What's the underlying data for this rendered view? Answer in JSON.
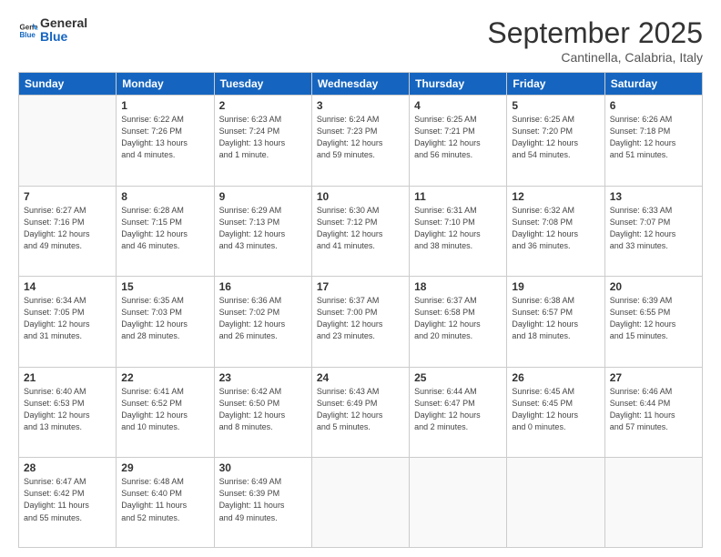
{
  "logo": {
    "line1": "General",
    "line2": "Blue"
  },
  "title": "September 2025",
  "subtitle": "Cantinella, Calabria, Italy",
  "days_header": [
    "Sunday",
    "Monday",
    "Tuesday",
    "Wednesday",
    "Thursday",
    "Friday",
    "Saturday"
  ],
  "weeks": [
    [
      {
        "day": "",
        "info": ""
      },
      {
        "day": "1",
        "info": "Sunrise: 6:22 AM\nSunset: 7:26 PM\nDaylight: 13 hours\nand 4 minutes."
      },
      {
        "day": "2",
        "info": "Sunrise: 6:23 AM\nSunset: 7:24 PM\nDaylight: 13 hours\nand 1 minute."
      },
      {
        "day": "3",
        "info": "Sunrise: 6:24 AM\nSunset: 7:23 PM\nDaylight: 12 hours\nand 59 minutes."
      },
      {
        "day": "4",
        "info": "Sunrise: 6:25 AM\nSunset: 7:21 PM\nDaylight: 12 hours\nand 56 minutes."
      },
      {
        "day": "5",
        "info": "Sunrise: 6:25 AM\nSunset: 7:20 PM\nDaylight: 12 hours\nand 54 minutes."
      },
      {
        "day": "6",
        "info": "Sunrise: 6:26 AM\nSunset: 7:18 PM\nDaylight: 12 hours\nand 51 minutes."
      }
    ],
    [
      {
        "day": "7",
        "info": "Sunrise: 6:27 AM\nSunset: 7:16 PM\nDaylight: 12 hours\nand 49 minutes."
      },
      {
        "day": "8",
        "info": "Sunrise: 6:28 AM\nSunset: 7:15 PM\nDaylight: 12 hours\nand 46 minutes."
      },
      {
        "day": "9",
        "info": "Sunrise: 6:29 AM\nSunset: 7:13 PM\nDaylight: 12 hours\nand 43 minutes."
      },
      {
        "day": "10",
        "info": "Sunrise: 6:30 AM\nSunset: 7:12 PM\nDaylight: 12 hours\nand 41 minutes."
      },
      {
        "day": "11",
        "info": "Sunrise: 6:31 AM\nSunset: 7:10 PM\nDaylight: 12 hours\nand 38 minutes."
      },
      {
        "day": "12",
        "info": "Sunrise: 6:32 AM\nSunset: 7:08 PM\nDaylight: 12 hours\nand 36 minutes."
      },
      {
        "day": "13",
        "info": "Sunrise: 6:33 AM\nSunset: 7:07 PM\nDaylight: 12 hours\nand 33 minutes."
      }
    ],
    [
      {
        "day": "14",
        "info": "Sunrise: 6:34 AM\nSunset: 7:05 PM\nDaylight: 12 hours\nand 31 minutes."
      },
      {
        "day": "15",
        "info": "Sunrise: 6:35 AM\nSunset: 7:03 PM\nDaylight: 12 hours\nand 28 minutes."
      },
      {
        "day": "16",
        "info": "Sunrise: 6:36 AM\nSunset: 7:02 PM\nDaylight: 12 hours\nand 26 minutes."
      },
      {
        "day": "17",
        "info": "Sunrise: 6:37 AM\nSunset: 7:00 PM\nDaylight: 12 hours\nand 23 minutes."
      },
      {
        "day": "18",
        "info": "Sunrise: 6:37 AM\nSunset: 6:58 PM\nDaylight: 12 hours\nand 20 minutes."
      },
      {
        "day": "19",
        "info": "Sunrise: 6:38 AM\nSunset: 6:57 PM\nDaylight: 12 hours\nand 18 minutes."
      },
      {
        "day": "20",
        "info": "Sunrise: 6:39 AM\nSunset: 6:55 PM\nDaylight: 12 hours\nand 15 minutes."
      }
    ],
    [
      {
        "day": "21",
        "info": "Sunrise: 6:40 AM\nSunset: 6:53 PM\nDaylight: 12 hours\nand 13 minutes."
      },
      {
        "day": "22",
        "info": "Sunrise: 6:41 AM\nSunset: 6:52 PM\nDaylight: 12 hours\nand 10 minutes."
      },
      {
        "day": "23",
        "info": "Sunrise: 6:42 AM\nSunset: 6:50 PM\nDaylight: 12 hours\nand 8 minutes."
      },
      {
        "day": "24",
        "info": "Sunrise: 6:43 AM\nSunset: 6:49 PM\nDaylight: 12 hours\nand 5 minutes."
      },
      {
        "day": "25",
        "info": "Sunrise: 6:44 AM\nSunset: 6:47 PM\nDaylight: 12 hours\nand 2 minutes."
      },
      {
        "day": "26",
        "info": "Sunrise: 6:45 AM\nSunset: 6:45 PM\nDaylight: 12 hours\nand 0 minutes."
      },
      {
        "day": "27",
        "info": "Sunrise: 6:46 AM\nSunset: 6:44 PM\nDaylight: 11 hours\nand 57 minutes."
      }
    ],
    [
      {
        "day": "28",
        "info": "Sunrise: 6:47 AM\nSunset: 6:42 PM\nDaylight: 11 hours\nand 55 minutes."
      },
      {
        "day": "29",
        "info": "Sunrise: 6:48 AM\nSunset: 6:40 PM\nDaylight: 11 hours\nand 52 minutes."
      },
      {
        "day": "30",
        "info": "Sunrise: 6:49 AM\nSunset: 6:39 PM\nDaylight: 11 hours\nand 49 minutes."
      },
      {
        "day": "",
        "info": ""
      },
      {
        "day": "",
        "info": ""
      },
      {
        "day": "",
        "info": ""
      },
      {
        "day": "",
        "info": ""
      }
    ]
  ]
}
